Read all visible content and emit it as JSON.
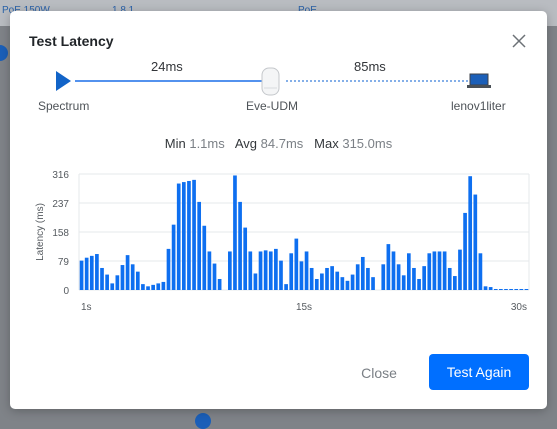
{
  "dialog": {
    "title": "Test Latency",
    "close_label": "Close",
    "primary_label": "Test Again"
  },
  "path": {
    "source": "Spectrum",
    "gateway": "Eve-UDM",
    "destination": "lenov1liter",
    "hop1_latency": "24ms",
    "hop2_latency": "85ms"
  },
  "stats": {
    "min_label": "Min",
    "min_value": "1.1ms",
    "avg_label": "Avg",
    "avg_value": "84.7ms",
    "max_label": "Max",
    "max_value": "315.0ms"
  },
  "colors": {
    "accent": "#006fff",
    "bar": "#0e6ff0",
    "title_text": "#212529"
  },
  "icons": {
    "source": "play-triangle-icon",
    "gateway": "router-icon",
    "destination": "laptop-icon",
    "close": "close-icon"
  },
  "chart_data": {
    "type": "bar",
    "ylabel": "Latency (ms)",
    "yticks": [
      316,
      237,
      158,
      79,
      0
    ],
    "ylim": [
      0,
      316
    ],
    "xticks": [
      "1s",
      "15s",
      "30s"
    ],
    "grid": true,
    "values": [
      80,
      88,
      93,
      98,
      60,
      42,
      18,
      40,
      68,
      95,
      70,
      50,
      16,
      10,
      14,
      18,
      22,
      112,
      178,
      290,
      294,
      297,
      300,
      240,
      175,
      105,
      72,
      30,
      0,
      105,
      312,
      240,
      170,
      105,
      45,
      105,
      108,
      105,
      112,
      80,
      16,
      100,
      140,
      78,
      105,
      60,
      30,
      45,
      60,
      65,
      50,
      35,
      25,
      42,
      70,
      90,
      60,
      35,
      0,
      70,
      125,
      105,
      70,
      40,
      100,
      60,
      30,
      65,
      100,
      105,
      105,
      105,
      60,
      38,
      110,
      210,
      310,
      260,
      100,
      10,
      8,
      2,
      2,
      2,
      2,
      2,
      2,
      2
    ]
  }
}
